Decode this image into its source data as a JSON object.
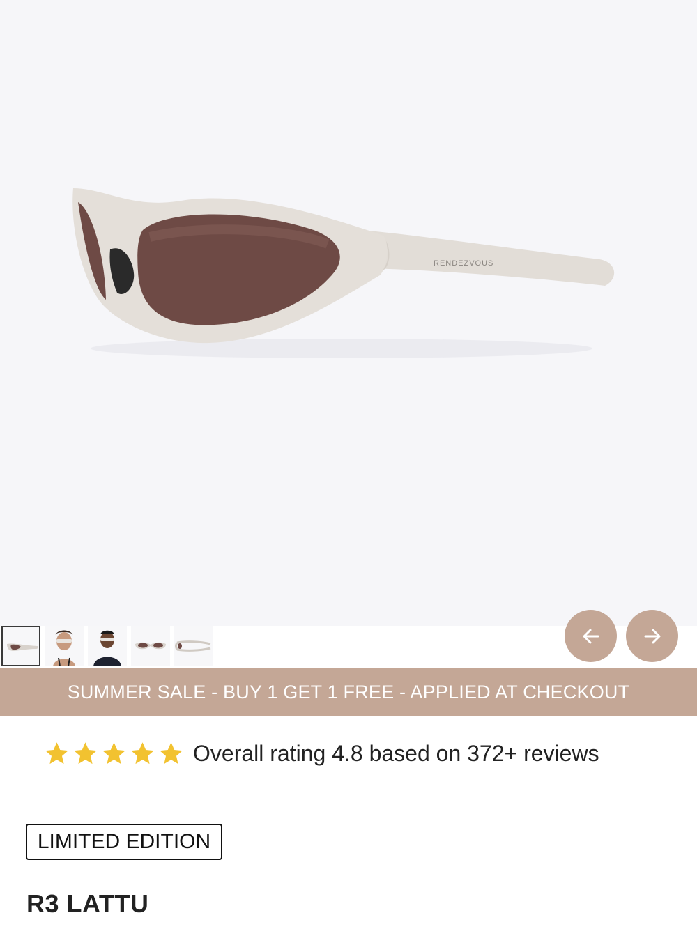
{
  "product": {
    "brand_mark": "RENDEZVOUS",
    "name": "R3 LATTU",
    "badge": "LIMITED EDITION"
  },
  "gallery": {
    "thumbnails": [
      {
        "name": "thumb-product-side",
        "active": true
      },
      {
        "name": "thumb-model-woman",
        "active": false
      },
      {
        "name": "thumb-model-man",
        "active": false
      },
      {
        "name": "thumb-product-front",
        "active": false
      },
      {
        "name": "thumb-product-top",
        "active": false
      }
    ],
    "prev_icon": "arrow-left-icon",
    "next_icon": "arrow-right-icon"
  },
  "promo": {
    "text": "SUMMER SALE - BUY 1 GET 1 FREE - APPLIED AT CHECKOUT"
  },
  "rating": {
    "stars": 5,
    "text": "Overall rating 4.8 based on 372+ reviews"
  },
  "colors": {
    "accent": "#c4a796",
    "star": "#f2c230",
    "hero_bg": "#f6f6f9"
  }
}
